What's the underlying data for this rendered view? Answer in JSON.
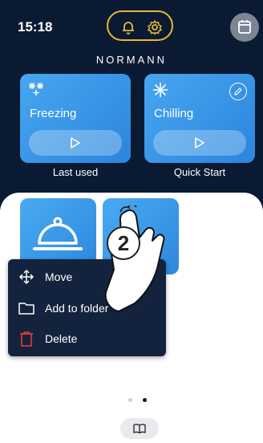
{
  "status": {
    "time": "15:18"
  },
  "header": {
    "brand": "NORMANN"
  },
  "cards": [
    {
      "label": "Freezing",
      "caption": "Last used"
    },
    {
      "label": "Chilling",
      "caption": "Quick Start"
    }
  ],
  "context_menu": {
    "items": [
      {
        "label": "Move",
        "icon": "move-arrows-icon"
      },
      {
        "label": "Add to folder",
        "icon": "folder-icon"
      },
      {
        "label": "Delete",
        "icon": "trash-icon"
      }
    ]
  },
  "step_badge": "2",
  "colors": {
    "header_bg": "#0b1a33",
    "accent_yellow": "#e7b932",
    "card_blue": "#3b97ea",
    "delete_red": "#e23b3b"
  }
}
